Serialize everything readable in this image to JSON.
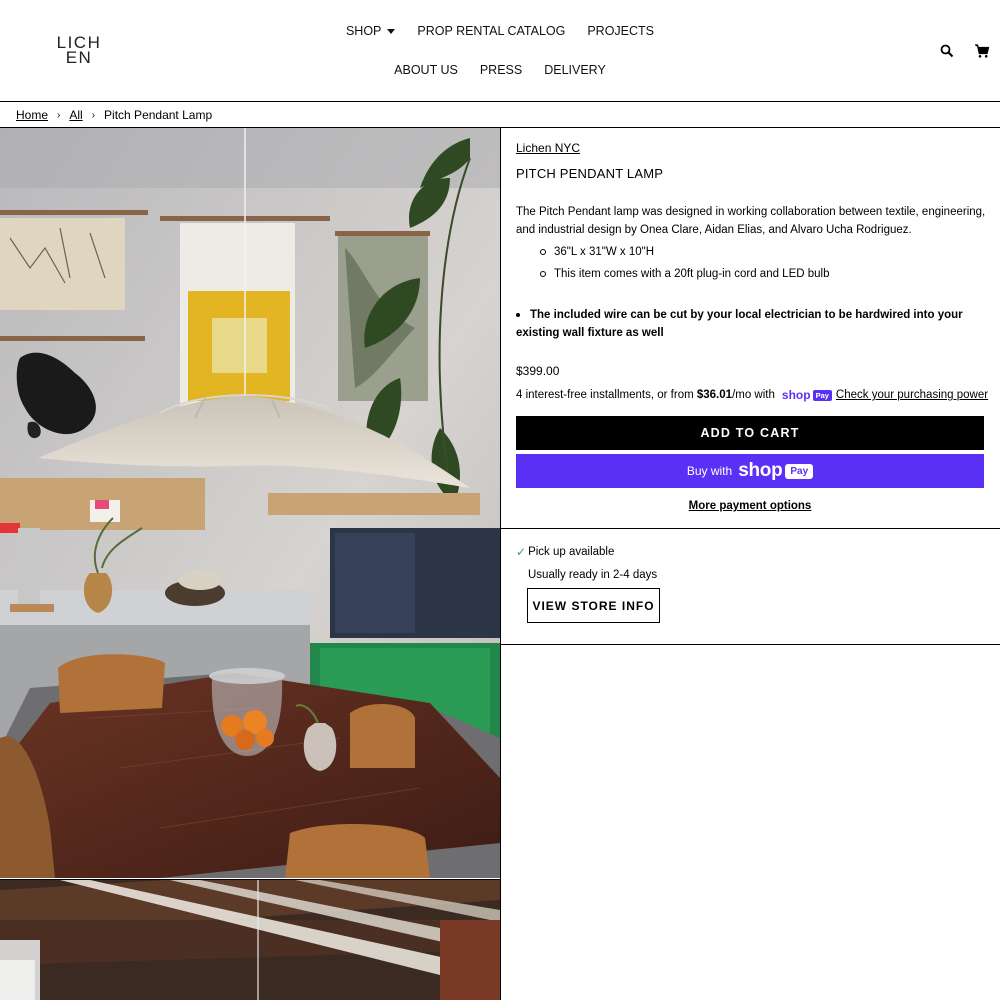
{
  "logo": {
    "line1": "LICH",
    "line2": "EN"
  },
  "nav": {
    "row1": [
      {
        "label": "SHOP",
        "has_dropdown": true
      },
      {
        "label": "PROP RENTAL CATALOG"
      },
      {
        "label": "PROJECTS"
      }
    ],
    "row2": [
      {
        "label": "ABOUT US"
      },
      {
        "label": "PRESS"
      },
      {
        "label": "DELIVERY"
      }
    ],
    "icons": [
      "search-icon",
      "cart-icon"
    ]
  },
  "breadcrumb": {
    "items": [
      "Home",
      "All"
    ],
    "separator": "›",
    "current": "Pitch Pendant Lamp"
  },
  "product": {
    "vendor": "Lichen NYC",
    "title": "PITCH PENDANT LAMP",
    "description": "The Pitch Pendant lamp was designed in working collaboration between textile, engineering, and industrial design by Onea Clare, Aidan Elias, and Alvaro Ucha Rodriguez.",
    "specs": [
      "36\"L x 31\"W x 10\"H",
      "This item comes with a 20ft plug-in cord and LED bulb"
    ],
    "note": "The included wire can be cut by your local electrician to be hardwired into your existing wall fixture as well",
    "price": "$399.00",
    "installments": {
      "prefix": "4 interest-free installments, or from",
      "amount": "$36.01",
      "suffix": "/mo with",
      "brand_word": "shop",
      "brand_pill": "Pay",
      "link": "Check your purchasing power"
    },
    "add_to_cart": "ADD TO CART",
    "buy_now": {
      "prefix": "Buy with",
      "brand_word": "shop",
      "brand_pill": "Pay"
    },
    "more_payment": "More payment options"
  },
  "pickup": {
    "status": "Pick up available",
    "ready": "Usually ready in 2-4 days",
    "button": "VIEW STORE INFO"
  },
  "colors": {
    "shop_pay": "#5a31f4",
    "check": "#3ba55c",
    "primary_button": "#000000"
  }
}
